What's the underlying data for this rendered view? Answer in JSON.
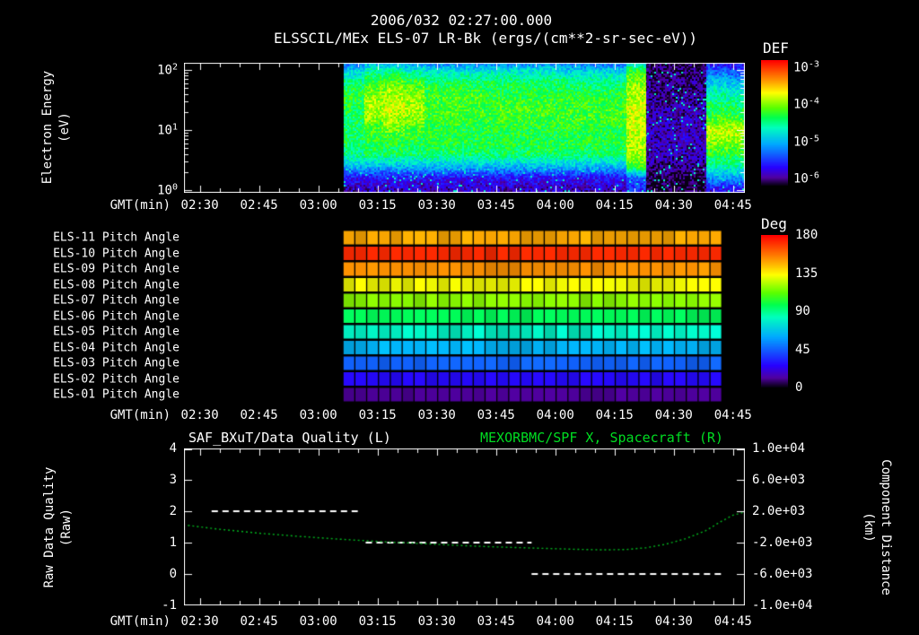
{
  "header": {
    "datetime": "2006/032 02:27:00.000",
    "title": "ELSSCIL/MEx ELS-07 LR-Bk (ergs/(cm**2-sr-sec-eV))"
  },
  "time_axis": {
    "label": "GMT(min)",
    "start_min": 146,
    "end_min": 288,
    "minor_step_min": 5,
    "ticks": [
      {
        "min": 150,
        "label": "02:30"
      },
      {
        "min": 165,
        "label": "02:45"
      },
      {
        "min": 180,
        "label": "03:00"
      },
      {
        "min": 195,
        "label": "03:15"
      },
      {
        "min": 210,
        "label": "03:30"
      },
      {
        "min": 225,
        "label": "03:45"
      },
      {
        "min": 240,
        "label": "04:00"
      },
      {
        "min": 255,
        "label": "04:15"
      },
      {
        "min": 270,
        "label": "04:30"
      },
      {
        "min": 285,
        "label": "04:45"
      }
    ]
  },
  "colors": {
    "background": "#000000",
    "frame": "#ffffff",
    "text": "#ffffff",
    "green_title": "#00dd22",
    "curve_green": "#00b41e",
    "quality_line": "#ffffff"
  },
  "chart_data": [
    {
      "type": "heatmap",
      "name": "electron-energy-spectrogram",
      "ylabel_lines": [
        "Electron Energy",
        "(eV)"
      ],
      "y_scale": "log",
      "y_ticks": [
        {
          "base": "10",
          "exp": "0",
          "value": 1
        },
        {
          "base": "10",
          "exp": "1",
          "value": 10
        },
        {
          "base": "10",
          "exp": "2",
          "value": 100
        }
      ],
      "y_range_ev": [
        1,
        145
      ],
      "colorbar": {
        "title": "DEF",
        "units": "ergs/(cm**2-sr-sec-eV)",
        "range_log10": [
          -6.2,
          -2.8
        ],
        "ticks": [
          {
            "base": "10",
            "exp": "-3",
            "value": -3
          },
          {
            "base": "10",
            "exp": "-4",
            "value": -4
          },
          {
            "base": "10",
            "exp": "-5",
            "value": -5
          },
          {
            "base": "10",
            "exp": "-6",
            "value": -6
          }
        ]
      },
      "data_start_min": 186.4,
      "column_minutes": 5.1,
      "energy_rows_ev": [
        1.0,
        1.6,
        2.5,
        4.0,
        6.3,
        10,
        16,
        25,
        40,
        63,
        100,
        145
      ],
      "values_log10": [
        [
          -5.9,
          -5.9,
          -5.9,
          -5.9,
          -5.9,
          -5.9,
          -5.9,
          -5.9,
          -5.9,
          -5.9,
          -5.9,
          -5.9,
          -5.9,
          -5.9,
          -5.6,
          -6.15,
          -6.15,
          -6.15,
          -5.8,
          -5.8
        ],
        [
          -5.7,
          -5.7,
          -5.7,
          -5.7,
          -5.7,
          -5.7,
          -5.7,
          -5.7,
          -5.7,
          -5.7,
          -5.7,
          -5.7,
          -5.7,
          -5.7,
          -5.4,
          -6.15,
          -6.15,
          -6.15,
          -5.1,
          -5.1
        ],
        [
          -5.0,
          -5.0,
          -5.0,
          -5.0,
          -5.0,
          -5.0,
          -5.0,
          -5.0,
          -5.0,
          -5.0,
          -5.0,
          -5.0,
          -5.0,
          -5.0,
          -4.2,
          -6.0,
          -6.0,
          -6.0,
          -4.6,
          -4.6
        ],
        [
          -4.5,
          -4.4,
          -4.4,
          -4.4,
          -4.4,
          -4.4,
          -4.4,
          -4.4,
          -4.4,
          -4.4,
          -4.4,
          -4.4,
          -4.4,
          -4.4,
          -3.9,
          -5.9,
          -5.9,
          -5.9,
          -4.3,
          -4.3
        ],
        [
          -4.4,
          -4.3,
          -4.3,
          -4.3,
          -4.3,
          -4.3,
          -4.3,
          -4.3,
          -4.3,
          -4.3,
          -4.3,
          -4.3,
          -4.3,
          -4.3,
          -3.9,
          -5.9,
          -5.9,
          -5.9,
          -4.0,
          -4.0
        ],
        [
          -4.4,
          -4.2,
          -4.1,
          -4.2,
          -4.3,
          -4.3,
          -4.3,
          -4.3,
          -4.3,
          -4.3,
          -4.3,
          -4.3,
          -4.3,
          -4.3,
          -3.8,
          -5.9,
          -5.9,
          -5.9,
          -3.8,
          -3.8
        ],
        [
          -4.4,
          -4.0,
          -3.9,
          -4.0,
          -4.2,
          -4.2,
          -4.2,
          -4.2,
          -4.2,
          -4.2,
          -4.2,
          -4.2,
          -4.2,
          -4.2,
          -3.8,
          -5.9,
          -5.9,
          -5.9,
          -4.2,
          -4.2
        ],
        [
          -4.3,
          -3.9,
          -3.8,
          -3.9,
          -4.2,
          -4.2,
          -4.2,
          -4.2,
          -4.2,
          -4.2,
          -4.2,
          -4.2,
          -4.2,
          -4.2,
          -3.8,
          -5.95,
          -5.95,
          -5.95,
          -4.4,
          -4.4
        ],
        [
          -4.3,
          -4.0,
          -3.9,
          -4.0,
          -4.2,
          -4.2,
          -4.2,
          -4.3,
          -4.3,
          -4.3,
          -4.3,
          -4.3,
          -4.3,
          -4.3,
          -3.9,
          -6.0,
          -6.0,
          -6.0,
          -4.6,
          -4.7
        ],
        [
          -4.5,
          -4.2,
          -4.1,
          -4.2,
          -4.4,
          -4.4,
          -4.4,
          -4.4,
          -4.4,
          -4.4,
          -4.4,
          -4.5,
          -4.5,
          -4.5,
          -4.0,
          -6.05,
          -6.05,
          -6.05,
          -4.9,
          -5.0
        ],
        [
          -4.9,
          -4.6,
          -4.6,
          -4.7,
          -4.8,
          -4.8,
          -4.8,
          -4.8,
          -4.8,
          -4.8,
          -4.8,
          -4.9,
          -4.9,
          -4.9,
          -4.3,
          -6.1,
          -6.1,
          -6.1,
          -5.4,
          -5.5
        ],
        [
          -5.5,
          -5.2,
          -5.2,
          -5.3,
          -5.4,
          -5.4,
          -5.4,
          -5.4,
          -5.4,
          -5.4,
          -5.4,
          -5.5,
          -5.5,
          -5.5,
          -4.9,
          -6.15,
          -6.15,
          -6.15,
          -5.8,
          -5.8
        ]
      ]
    },
    {
      "type": "heatmap",
      "name": "pitch-angle-bands",
      "colorbar": {
        "title": "Deg",
        "range_deg": [
          0,
          180
        ],
        "ticks": [
          180,
          135,
          90,
          45,
          0
        ]
      },
      "data_start_min": 186.4,
      "data_end_min": 282.3,
      "cell_count": 32,
      "rows": [
        {
          "label": "ELS-11 Pitch Angle",
          "pitch_deg": 148
        },
        {
          "label": "ELS-10 Pitch Angle",
          "pitch_deg": 172
        },
        {
          "label": "ELS-09 Pitch Angle",
          "pitch_deg": 152
        },
        {
          "label": "ELS-08 Pitch Angle",
          "pitch_deg": 132
        },
        {
          "label": "ELS-07 Pitch Angle",
          "pitch_deg": 118
        },
        {
          "label": "ELS-06 Pitch Angle",
          "pitch_deg": 96
        },
        {
          "label": "ELS-05 Pitch Angle",
          "pitch_deg": 80
        },
        {
          "label": "ELS-04 Pitch Angle",
          "pitch_deg": 62
        },
        {
          "label": "ELS-03 Pitch Angle",
          "pitch_deg": 45
        },
        {
          "label": "ELS-02 Pitch Angle",
          "pitch_deg": 27
        },
        {
          "label": "ELS-01 Pitch Angle",
          "pitch_deg": 10
        }
      ]
    },
    {
      "type": "line",
      "name": "data-quality-and-spacecraft-x",
      "title_left": "SAF_BXuT/Data Quality (L)",
      "title_right": "MEXORBMC/SPF X, Spacecraft (R)",
      "ylabel_left_lines": [
        "Raw Data Quality",
        "(Raw)"
      ],
      "ylabel_right_lines": [
        "Component Distance",
        "(km)"
      ],
      "y_left": {
        "range": [
          -1,
          4
        ],
        "ticks": [
          "4",
          "3",
          "2",
          "1",
          "0",
          "-1"
        ],
        "tick_values": [
          4,
          3,
          2,
          1,
          0,
          -1
        ]
      },
      "y_right": {
        "range_km": [
          -10000,
          10000
        ],
        "ticks": [
          "1.0e+04",
          "6.0e+03",
          "2.0e+03",
          "-2.0e+03",
          "-6.0e+03",
          "-1.0e+04"
        ],
        "tick_values_km": [
          10000,
          6000,
          2000,
          -2000,
          -6000,
          -10000
        ]
      },
      "series": [
        {
          "name": "Data Quality",
          "axis": "left",
          "style": "dashed-white",
          "segments": [
            {
              "value": 2,
              "start_min": 153,
              "end_min": 190
            },
            {
              "value": 1,
              "start_min": 192,
              "end_min": 234
            },
            {
              "value": 0,
              "start_min": 234,
              "end_min": 283
            }
          ]
        },
        {
          "name": "Spacecraft X",
          "axis": "right",
          "style": "dotted-green",
          "x_min": [
            147,
            155,
            165,
            175,
            185,
            195,
            205,
            215,
            225,
            235,
            245,
            252,
            258,
            263,
            268,
            273,
            278,
            282,
            285,
            288
          ],
          "km": [
            200,
            -300,
            -800,
            -1200,
            -1550,
            -1850,
            -2100,
            -2350,
            -2550,
            -2700,
            -2850,
            -2920,
            -2880,
            -2650,
            -2200,
            -1500,
            -500,
            700,
            1500,
            1900
          ]
        }
      ]
    }
  ]
}
